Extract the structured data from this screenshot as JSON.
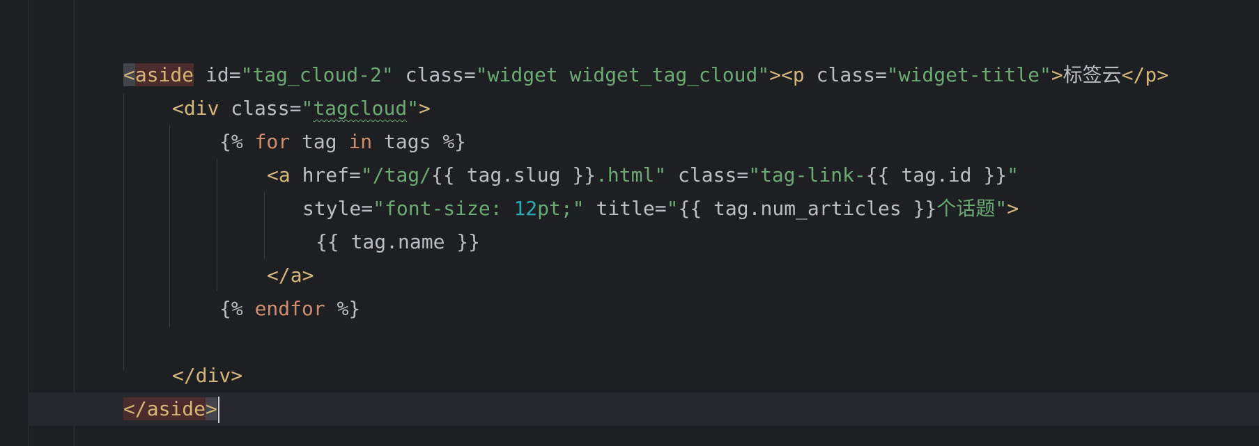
{
  "editor": {
    "colors": {
      "background": "#1e1f22",
      "current_line": "#26282e",
      "tag": "#d5b778",
      "string": "#6aab73",
      "number": "#2aacb8",
      "keyword": "#cf8e6d",
      "text": "#bcbec4"
    },
    "lines": {
      "l1": {
        "open": "<",
        "tag": "aside",
        "a1_name": " id",
        "a1_eq": "=",
        "a1_val": "\"tag_cloud-2\"",
        "a2_name": " class",
        "a2_eq": "=",
        "a2_val": "\"widget widget_tag_cloud\"",
        "gt": ">",
        "p_open": "<p",
        "p_attr": " class",
        "p_eq": "=",
        "p_val": "\"widget-title\"",
        "p_gt": ">",
        "text": "标签云",
        "p_close": "</p>"
      },
      "l2": {
        "open": "<div",
        "attr": " class",
        "eq": "=",
        "q1": "\"",
        "val": "tagcloud",
        "q2": "\"",
        "gt": ">"
      },
      "l3": {
        "open": "{%",
        "kw": " for",
        "v1": " tag",
        "kw2": " in",
        "v2": " tags",
        "close": " %}"
      },
      "l4": {
        "open": "<a",
        "attr": " href",
        "eq": "=",
        "val1": "\"/tag/",
        "tmpl": "{{ tag.slug }}",
        "val2": ".html\"",
        "attr2": " class",
        "eq2": "=",
        "val3": "\"tag-link-",
        "tmpl2": "{{ tag.id }}",
        "val4": "\""
      },
      "l5": {
        "attr": "style",
        "eq": "=",
        "val1": "\"font-size: ",
        "num": "12",
        "unit": "pt",
        "val2": ";\"",
        "attr2": " title",
        "eq2": "=",
        "val3": "\"",
        "tmpl": "{{ tag.num_articles }}",
        "val4": "个话题\"",
        "gt": ">"
      },
      "l6": {
        "text": "{{ tag.name }}"
      },
      "l7": {
        "close": "</a>"
      },
      "l8": {
        "open": "{%",
        "kw": " endfor",
        "close": " %}"
      },
      "l10": {
        "close": "</div>"
      },
      "l11": {
        "open": "</",
        "tag": "aside",
        "gt": ">"
      }
    }
  }
}
